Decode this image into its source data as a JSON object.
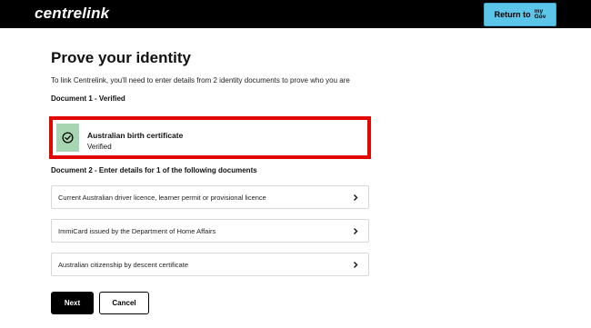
{
  "header": {
    "logo": "centrelink",
    "return_label": "Return to",
    "mygov_line1": "my",
    "mygov_line2": "Gov"
  },
  "page": {
    "title": "Prove your identity",
    "intro": "To link Centrelink, you'll need to enter details from 2 identity documents to prove who you are"
  },
  "document1": {
    "heading": "Document 1 - Verified",
    "name": "Australian birth certificate",
    "status": "Verified",
    "highlight_color": "#e10600",
    "strip_color": "#a8d5b1",
    "icon": "check-circle-icon"
  },
  "document2": {
    "heading": "Document 2 - Enter details for 1 of the following documents",
    "options": [
      {
        "label": "Current Australian driver licence, learner permit or provisional licence"
      },
      {
        "label": "ImmiCard issued by the Department of Home Affairs"
      },
      {
        "label": "Australian citizenship by descent certificate"
      }
    ]
  },
  "actions": {
    "next_label": "Next",
    "cancel_label": "Cancel"
  },
  "colors": {
    "topbar": "#000000",
    "return_button": "#5bc6ea"
  }
}
